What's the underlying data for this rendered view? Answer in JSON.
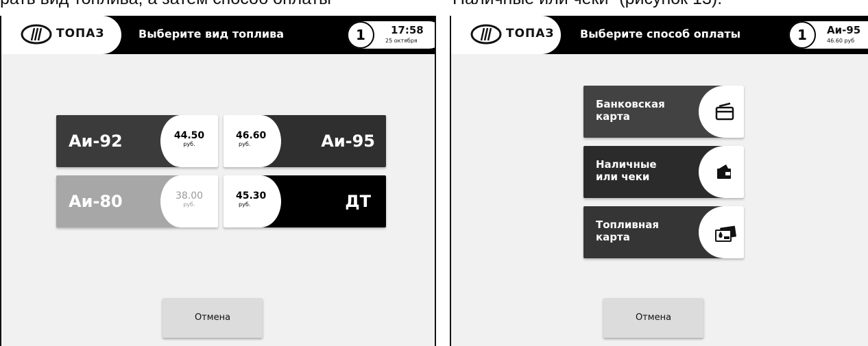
{
  "caption": {
    "left": "рать вид топлива, а затем способ оплаты",
    "right": "Наличные или чеки\" (рисунок 13)."
  },
  "screen_fuel": {
    "logo_text": "ТОПАЗ",
    "title": "Выберите вид топлива",
    "pump_number": "1",
    "time": "17:58",
    "date": "25 октября",
    "fuels": [
      {
        "name": "Аи-92",
        "price": "44.50",
        "unit": "руб.",
        "color": "#3b3b3b"
      },
      {
        "name": "Аи-95",
        "price": "46.60",
        "unit": "руб.",
        "color": "#2f2f2f"
      },
      {
        "name": "Аи-80",
        "price": "38.00",
        "unit": "руб.",
        "color": "#a7a7a7"
      },
      {
        "name": "ДТ",
        "price": "45.30",
        "unit": "руб.",
        "color": "#000000"
      }
    ],
    "cancel_label": "Отмена"
  },
  "screen_payment": {
    "logo_text": "ТОПАЗ",
    "title": "Выберите способ оплаты",
    "pump_number": "1",
    "fuel": "Аи-95",
    "price": "46.60 руб",
    "methods": [
      {
        "label": "Банковская карта",
        "icon": "credit-card-icon",
        "color": "#424242"
      },
      {
        "label": "Наличные или чеки",
        "icon": "wallet-icon",
        "color": "#2b2b2b"
      },
      {
        "label": "Топливная карта",
        "icon": "fuel-card-icon",
        "color": "#353535"
      }
    ],
    "cancel_label": "Отмена"
  }
}
